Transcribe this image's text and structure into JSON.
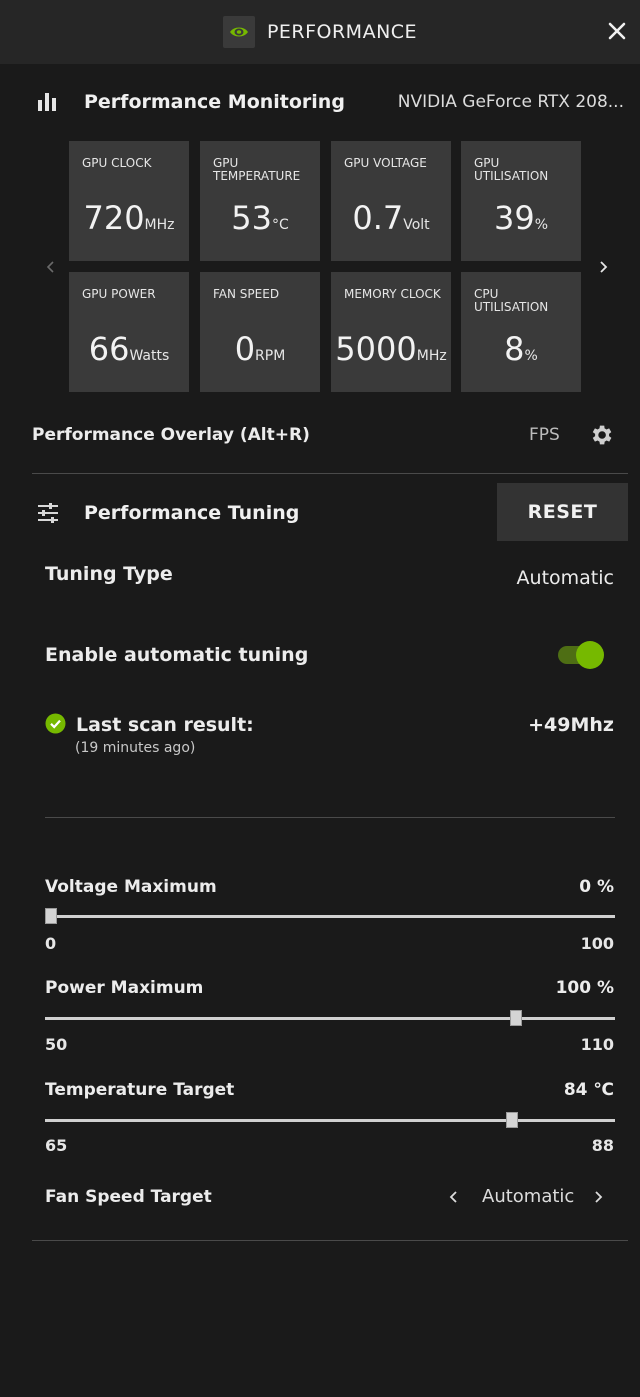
{
  "titlebar": {
    "title": "PERFORMANCE"
  },
  "monitoring": {
    "title": "Performance Monitoring",
    "gpu_name": "NVIDIA GeForce RTX 208..."
  },
  "tiles": [
    {
      "label": "GPU CLOCK",
      "value": "720",
      "unit": "MHz"
    },
    {
      "label": "GPU TEMPERATURE",
      "value": "53",
      "unit": "°C"
    },
    {
      "label": "GPU VOLTAGE",
      "value": "0.7",
      "unit": "Volt"
    },
    {
      "label": "GPU UTILISATION",
      "value": "39",
      "unit": "%"
    },
    {
      "label": "GPU POWER",
      "value": "66",
      "unit": "Watts"
    },
    {
      "label": "FAN SPEED",
      "value": "0",
      "unit": "RPM"
    },
    {
      "label": "MEMORY CLOCK",
      "value": "5000",
      "unit": "MHz"
    },
    {
      "label": "CPU UTILISATION",
      "value": "8",
      "unit": "%"
    }
  ],
  "overlay": {
    "label": "Performance Overlay (Alt+R)",
    "fps_label": "FPS"
  },
  "tuning": {
    "title": "Performance Tuning",
    "reset_label": "RESET",
    "tuning_type_label": "Tuning Type",
    "tuning_type_value": "Automatic",
    "auto_tuning_label": "Enable automatic tuning",
    "auto_tuning_enabled": true,
    "last_scan_label": "Last scan result:",
    "last_scan_ago": "(19 minutes ago)",
    "last_scan_value": "+49Mhz"
  },
  "sliders": {
    "voltage": {
      "label": "Voltage Maximum",
      "value": "0 %",
      "min": "0",
      "max": "100",
      "level": 0
    },
    "power": {
      "label": "Power Maximum",
      "value": "100 %",
      "min": "50",
      "max": "110",
      "level": 0.833
    },
    "temperature": {
      "label": "Temperature Target",
      "value": "84 ℃",
      "min": "65",
      "max": "88",
      "level": 0.826
    }
  },
  "fan": {
    "label": "Fan Speed Target",
    "value": "Automatic"
  },
  "colors": {
    "accent": "#76b900",
    "background": "#1a1a1a",
    "tile": "#3a3a3a"
  }
}
